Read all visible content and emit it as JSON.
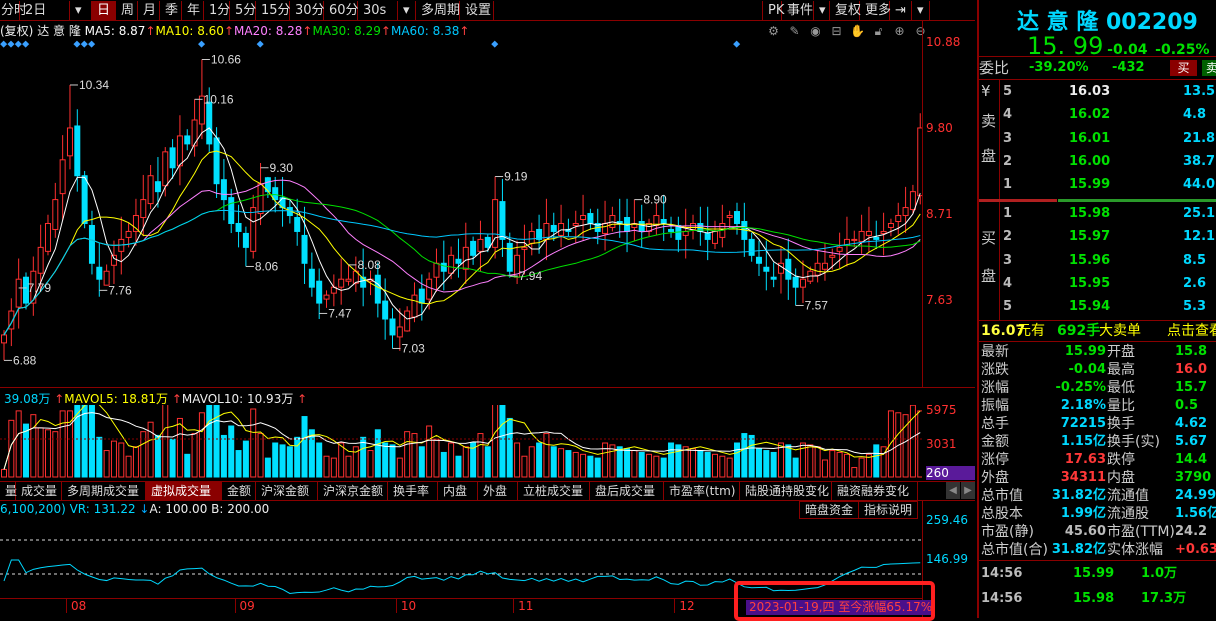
{
  "toolbar": {
    "items": [
      "分时",
      "2日",
      "▾",
      "日",
      "周",
      "月",
      "季",
      "年",
      "1分",
      "5分",
      "15分",
      "30分",
      "60分",
      "30s",
      "▾",
      "多周期",
      "设置"
    ],
    "active": "日",
    "right": [
      "PK",
      "事件",
      "▾",
      "复权",
      "更多",
      "⇥",
      "▾"
    ]
  },
  "legend": {
    "prefix": "(复权)",
    "name": "达 意 隆",
    "ma5": "MA5: 8.87",
    "ma10": "MA10: 8.60",
    "ma20": "MA20: 8.28",
    "ma30": "MA30: 8.29",
    "ma60": "MA60: 8.38",
    "arrow": "↑"
  },
  "chart_icons": [
    "gear-icon",
    "pen-icon",
    "eye-icon",
    "toolbox-icon",
    "hand-icon",
    "lock-icon",
    "zoom-in-icon",
    "zoom-out-icon"
  ],
  "colors": {
    "up": "#ff3030",
    "down": "#00e0ff",
    "ma5": "#ffffff",
    "ma10": "#ffff00",
    "ma20": "#ff80ff",
    "ma30": "#00e000",
    "ma60": "#00c8ff",
    "panel_border": "#8a0000"
  },
  "chart_data": {
    "type": "candlestick",
    "price_axis": {
      "ticks": [
        "10.88",
        "9.80",
        "8.71",
        "7.63"
      ],
      "range": [
        6.5,
        10.88
      ]
    },
    "closes": [
      7.2,
      7.5,
      7.9,
      7.6,
      8.0,
      8.3,
      8.6,
      8.9,
      9.4,
      9.8,
      9.2,
      8.6,
      8.1,
      7.9,
      8.0,
      8.2,
      8.4,
      8.5,
      8.7,
      8.9,
      9.2,
      9.0,
      9.5,
      9.3,
      9.7,
      9.6,
      9.9,
      10.2,
      9.6,
      9.1,
      8.9,
      8.6,
      8.5,
      8.3,
      8.8,
      9.1,
      9.0,
      8.9,
      8.8,
      8.7,
      8.5,
      8.1,
      7.8,
      7.6,
      7.7,
      7.8,
      7.9,
      7.9,
      8.0,
      7.8,
      7.9,
      7.6,
      7.4,
      7.2,
      7.3,
      7.5,
      7.7,
      7.6,
      7.9,
      8.1,
      8.0,
      8.2,
      8.1,
      8.3,
      8.2,
      8.4,
      8.3,
      8.9,
      8.4,
      8.0,
      8.2,
      8.3,
      8.5,
      8.4,
      8.6,
      8.5,
      8.6,
      8.5,
      8.6,
      8.7,
      8.6,
      8.5,
      8.6,
      8.7,
      8.6,
      8.5,
      8.6,
      8.5,
      8.6,
      8.7,
      8.6,
      8.5,
      8.4,
      8.5,
      8.6,
      8.5,
      8.4,
      8.5,
      8.6,
      8.7,
      8.6,
      8.4,
      8.2,
      8.1,
      8.0,
      7.9,
      8.1,
      7.9,
      7.8,
      7.9,
      8.0,
      8.1,
      8.1,
      8.2,
      8.3,
      8.4,
      8.4,
      8.5,
      8.5,
      8.4,
      8.5,
      8.6,
      8.7,
      8.8,
      9.0,
      9.8
    ],
    "annotations": [
      {
        "i": 9,
        "text": "10.34",
        "p": 10.34
      },
      {
        "i": 13,
        "text": "7.76",
        "p": 7.76
      },
      {
        "i": 2,
        "text": "7.79",
        "p": 7.79
      },
      {
        "i": 27,
        "text": "10.66",
        "p": 10.66
      },
      {
        "i": 26,
        "text": "10.16",
        "p": 10.16
      },
      {
        "i": 33,
        "text": "8.06",
        "p": 8.06
      },
      {
        "i": 35,
        "text": "9.30",
        "p": 9.3
      },
      {
        "i": 43,
        "text": "7.47",
        "p": 7.47
      },
      {
        "i": 47,
        "text": "8.08",
        "p": 8.08
      },
      {
        "i": 53,
        "text": "7.03",
        "p": 7.03
      },
      {
        "i": 67,
        "text": "9.19",
        "p": 9.19
      },
      {
        "i": 69,
        "text": "7.94",
        "p": 7.94
      },
      {
        "i": 86,
        "text": "8.90",
        "p": 8.9
      },
      {
        "i": 108,
        "text": "7.57",
        "p": 7.57
      },
      {
        "i": 0,
        "text": "6.88",
        "p": 6.88
      }
    ],
    "volume": {
      "legend": "39.08万",
      "mavol5": "MAVOL5: 18.81万",
      "mavol10": "MAVOL10: 10.93万",
      "ticks": [
        "5975",
        "3031",
        "260"
      ]
    },
    "vr": {
      "legend": "6,100,200) VR: 131.22",
      "arrow": "↓",
      "a": "A: 100.00",
      "b": "B: 200.00",
      "ticks": [
        "259.46",
        "146.99"
      ]
    },
    "x_ticks": [
      {
        "i": 9,
        "label": "08"
      },
      {
        "i": 32,
        "label": "09"
      },
      {
        "i": 54,
        "label": "10"
      },
      {
        "i": 70,
        "label": "11"
      },
      {
        "i": 92,
        "label": "12"
      }
    ]
  },
  "tabs": [
    "量",
    "成交量",
    "多周期成交量",
    "虚拟成交量",
    "金额",
    "沪深金额",
    "沪深京金额",
    "换手率",
    "内盘",
    "外盘",
    "立桩成交量",
    "盘后成交量",
    "市盈率(ttm)",
    "陆股通持股变化",
    "融资融券变化"
  ],
  "active_tab": "虚拟成交量",
  "indicator_buttons": [
    "暗盘资金",
    "指标说明"
  ],
  "date_tip": "2023-01-19,四 至今涨幅65.17%",
  "quote": {
    "name": "达 意 隆",
    "code": "002209",
    "price": "15. 99",
    "change": "-0.04",
    "pct": "-0.25%",
    "weibi_label": "委比",
    "weibi": "-39.20%",
    "weicha": "-432",
    "buy": "买",
    "sell": "卖",
    "sell_label": [
      "¥",
      "卖",
      "盘"
    ],
    "buy_label": [
      "买",
      "盘"
    ],
    "asks": [
      {
        "n": "5",
        "p": "16.03",
        "v": "13.5"
      },
      {
        "n": "4",
        "p": "16.02",
        "v": "4.8"
      },
      {
        "n": "3",
        "p": "16.01",
        "v": "21.8"
      },
      {
        "n": "2",
        "p": "16.00",
        "v": "38.7"
      },
      {
        "n": "1",
        "p": "15.99",
        "v": "44.0"
      }
    ],
    "bids": [
      {
        "n": "1",
        "p": "15.98",
        "v": "25.1"
      },
      {
        "n": "2",
        "p": "15.97",
        "v": "12.1"
      },
      {
        "n": "3",
        "p": "15.96",
        "v": "8.5"
      },
      {
        "n": "4",
        "p": "15.95",
        "v": "2.6"
      },
      {
        "n": "5",
        "p": "15.94",
        "v": "5.3"
      }
    ],
    "big_order": {
      "price": "16.07",
      "t1": "元有",
      "qty": "692手",
      "t2": "大卖单",
      "link": "点击查看"
    },
    "stats": [
      [
        "最新",
        "15.99",
        "g",
        "开盘",
        "15.8",
        "g"
      ],
      [
        "涨跌",
        "-0.04",
        "g",
        "最高",
        "16.0",
        "r"
      ],
      [
        "涨幅",
        "-0.25%",
        "g",
        "最低",
        "15.7",
        "g"
      ],
      [
        "振幅",
        "2.18%",
        "c",
        "量比",
        "0.5",
        "g"
      ],
      [
        "总手",
        "72215",
        "c",
        "换手",
        "4.62",
        "c"
      ],
      [
        "金额",
        "1.15亿",
        "c",
        "换手(实)",
        "5.67",
        "c"
      ],
      [
        "涨停",
        "17.63",
        "r",
        "跌停",
        "14.4",
        "g"
      ],
      [
        "外盘",
        "34311",
        "r",
        "内盘",
        "3790",
        "g"
      ],
      [
        "总市值",
        "31.82亿",
        "c",
        "流通值",
        "24.99亿",
        "c"
      ],
      [
        "总股本",
        "1.99亿",
        "c",
        "流通股",
        "1.56亿",
        "c"
      ],
      [
        "市盈(静)",
        "45.60",
        "gr",
        "市盈(TTM)",
        "24.2",
        "gr"
      ],
      [
        "总市值(合)",
        "31.82亿",
        "c",
        "实体涨幅",
        "+0.63",
        "r"
      ]
    ],
    "ticks": [
      {
        "t": "14:56",
        "p": "15.99",
        "v": "1.0万"
      },
      {
        "t": "14:56",
        "p": "15.98",
        "v": "17.3万"
      }
    ]
  }
}
